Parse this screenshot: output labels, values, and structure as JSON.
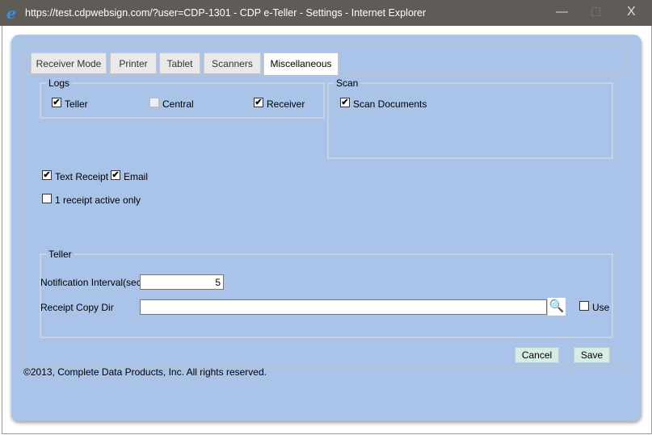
{
  "window": {
    "title": "https://test.cdpwebsign.com/?user=CDP-1301 - CDP e-Teller - Settings - Internet Explorer",
    "minimize": "—",
    "maximize": "☐",
    "close": "X"
  },
  "tabs": [
    {
      "label": "Receiver Mode"
    },
    {
      "label": "Printer"
    },
    {
      "label": "Tablet"
    },
    {
      "label": "Scanners"
    },
    {
      "label": "Miscellaneous",
      "active": true
    }
  ],
  "logs": {
    "legend": "Logs",
    "teller": {
      "label": "Teller",
      "checked": true
    },
    "central": {
      "label": "Central",
      "checked": false,
      "disabled": true
    },
    "receiver": {
      "label": "Receiver",
      "checked": true
    }
  },
  "scan": {
    "legend": "Scan",
    "scan_documents": {
      "label": "Scan Documents",
      "checked": true
    }
  },
  "receipt": {
    "text_receipt": {
      "label": "Text Receipt",
      "checked": true
    },
    "email": {
      "label": "Email",
      "checked": true
    },
    "one_active": {
      "label": "1 receipt active only",
      "checked": false
    }
  },
  "teller": {
    "legend": "Teller",
    "notification_label": "Notification Interval(sec)",
    "notification_value": "5",
    "copy_dir_label": "Receipt Copy Dir",
    "copy_dir_value": "",
    "use": {
      "label": "Use",
      "checked": false
    }
  },
  "buttons": {
    "cancel": "Cancel",
    "save": "Save"
  },
  "footer": {
    "copyright": "©2013, Complete Data Products, Inc. All rights reserved."
  },
  "check_glyph": "✔"
}
